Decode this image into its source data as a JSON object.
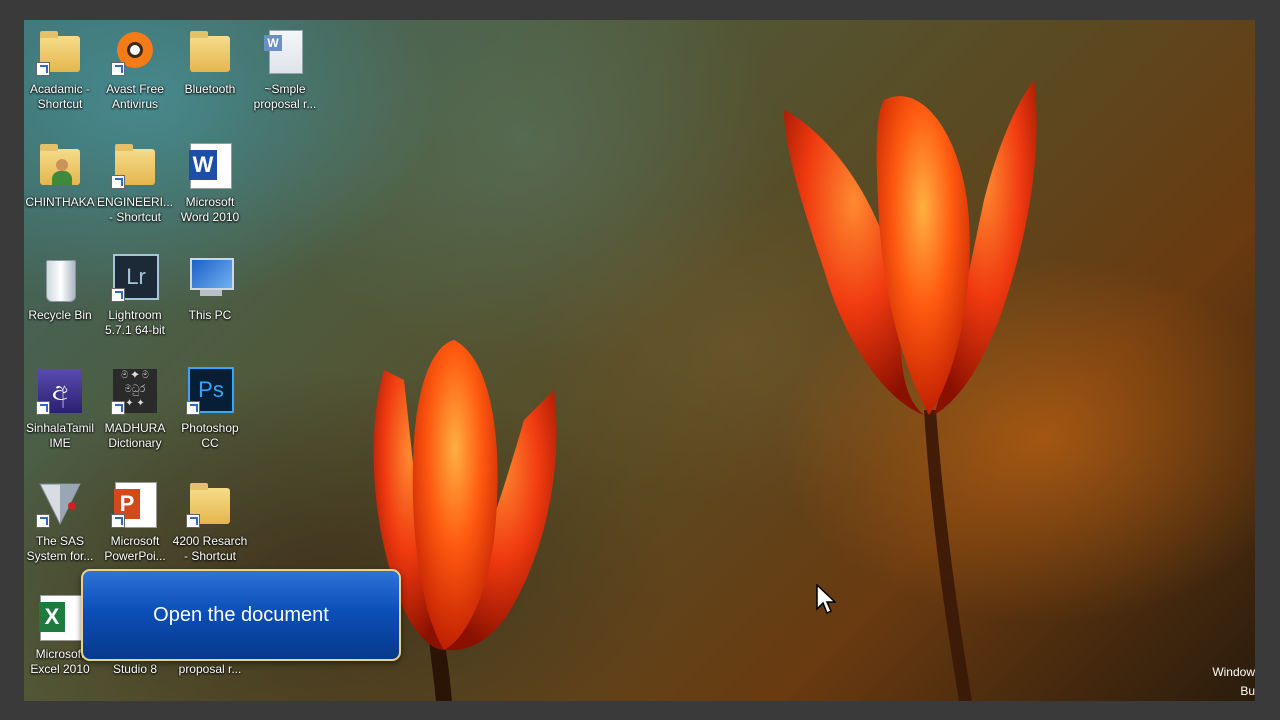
{
  "desktop": {
    "icons": [
      {
        "label": "Acadamic - Shortcut",
        "kind": "folder-icon",
        "shortcut": true
      },
      {
        "label": "Avast Free Antivirus",
        "kind": "avast-icon",
        "shortcut": true
      },
      {
        "label": "Bluetooth",
        "kind": "folder-icon",
        "shortcut": false
      },
      {
        "label": "~Smple proposal r...",
        "kind": "word-document-icon",
        "shortcut": false
      },
      {
        "label": "CHINTHAKA",
        "kind": "user-folder-icon",
        "shortcut": false
      },
      {
        "label": "ENGINEERI... - Shortcut",
        "kind": "folder-icon",
        "shortcut": true
      },
      {
        "label": "Microsoft Word 2010",
        "kind": "word-icon",
        "shortcut": false
      },
      {
        "label": "Recycle Bin",
        "kind": "recycle-bin-icon",
        "shortcut": false
      },
      {
        "label": "Lightroom 5.7.1 64-bit",
        "kind": "lightroom-icon",
        "shortcut": true
      },
      {
        "label": "This PC",
        "kind": "computer-icon",
        "shortcut": false
      },
      {
        "label": "SinhalaTamil IME",
        "kind": "sinhala-ime-icon",
        "shortcut": true
      },
      {
        "label": "MADHURA Dictionary",
        "kind": "dictionary-icon",
        "shortcut": true
      },
      {
        "label": "Photoshop CC",
        "kind": "photoshop-icon",
        "shortcut": true
      },
      {
        "label": "The SAS System for...",
        "kind": "sas-icon",
        "shortcut": true
      },
      {
        "label": "Microsoft PowerPoi...",
        "kind": "powerpoint-icon",
        "shortcut": true
      },
      {
        "label": "4200 Resarch - Shortcut",
        "kind": "folder-icon",
        "shortcut": true
      },
      {
        "label": "Microsoft Excel 2010",
        "kind": "excel-icon",
        "shortcut": false
      },
      {
        "label": "Studio 8",
        "kind": "studio-icon",
        "shortcut": true
      },
      {
        "label": "proposal r...",
        "kind": "word-document-icon",
        "shortcut": false
      }
    ]
  },
  "tooltip": {
    "text": "Open the document"
  },
  "watermark": {
    "line1": "Window",
    "line2": "Bu"
  },
  "colors": {
    "tooltip_blue": "#0b4fb8",
    "tooltip_border": "#e8d28a",
    "label_text": "#ffffff"
  }
}
